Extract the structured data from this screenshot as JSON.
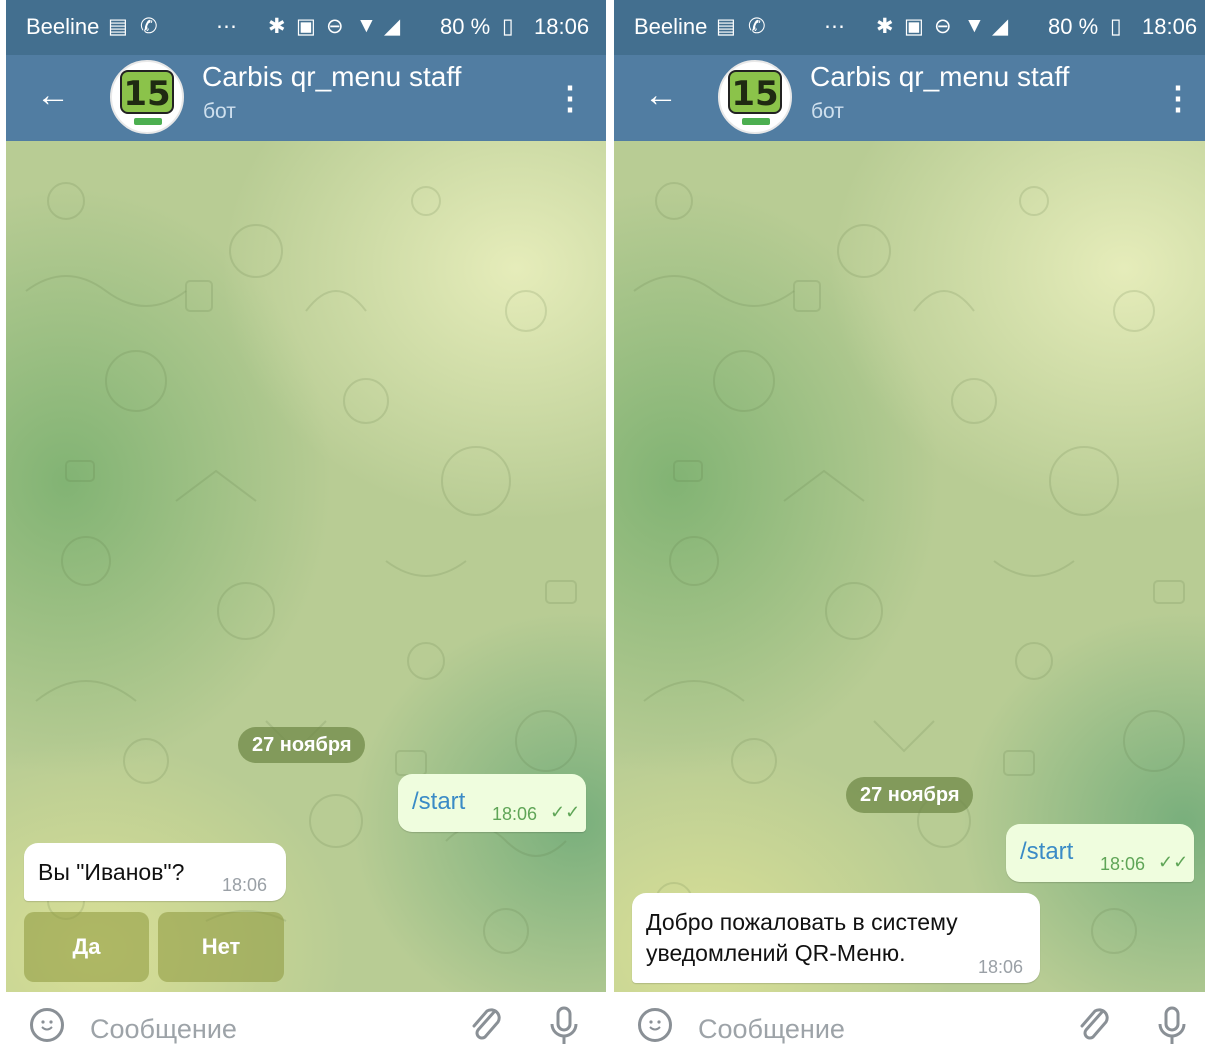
{
  "status_bar": {
    "carrier": "Beeline",
    "battery": "80 %",
    "time": "18:06"
  },
  "chat_header": {
    "title": "Carbis qr_menu staff",
    "subtitle": "бот",
    "avatar_text": "15"
  },
  "date_separator": "27 ноября",
  "left_screen": {
    "outgoing": {
      "text": "/start",
      "time": "18:06"
    },
    "incoming": {
      "text": "Вы \"Иванов\"?",
      "time": "18:06"
    },
    "keyboard": [
      {
        "label": "Да"
      },
      {
        "label": "Нет"
      }
    ]
  },
  "right_screen": {
    "outgoing": {
      "text": "/start",
      "time": "18:06"
    },
    "incoming": {
      "line1": "Добро пожаловать в систему",
      "line2": "уведомлений QR-Меню.",
      "time": "18:06"
    }
  },
  "input": {
    "placeholder": "Сообщение"
  },
  "icons": [
    "whatsapp-icon",
    "notification-icon",
    "bluetooth-icon",
    "nfc-icon",
    "dnd-icon",
    "wifi-icon",
    "signal-icon",
    "battery-charging-icon",
    "back-arrow-icon",
    "more-vert-icon",
    "read-ticks-icon",
    "emoji-icon",
    "attach-icon",
    "mic-icon"
  ],
  "colors": {
    "header": "#517da2",
    "statusbar": "#436f8f",
    "outgoing_bubble": "#effdde",
    "link": "#3a8bc6"
  }
}
